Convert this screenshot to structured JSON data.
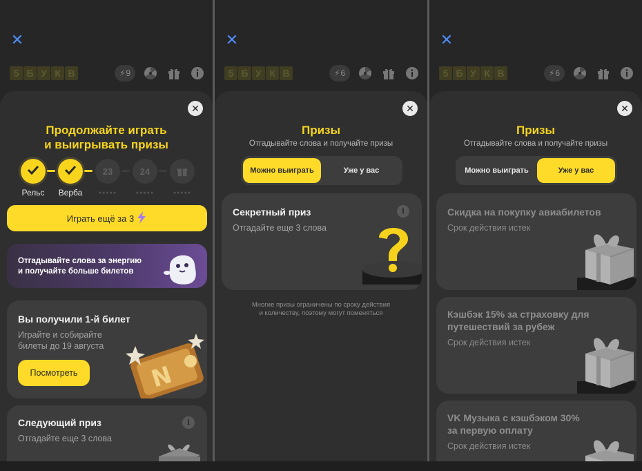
{
  "common": {
    "close_glyph": "✕",
    "sheet_close_glyph": "✕",
    "logo_letters": [
      "5",
      "Б",
      "У",
      "К",
      "В"
    ],
    "info_glyph": "i",
    "accent": "#fddb28",
    "close_color": "#4e8df5"
  },
  "screen1": {
    "energy_count": "9",
    "title_line1": "Продолжайте играть",
    "title_line2": "и выигрывать призы",
    "steps": [
      {
        "label": "Рельс",
        "state": "done"
      },
      {
        "label": "Верба",
        "state": "done"
      },
      {
        "label": "23",
        "state": "todo"
      },
      {
        "label": "24",
        "state": "todo"
      },
      {
        "label": "gift-icon",
        "state": "todo"
      }
    ],
    "step_dots": "●●●●●",
    "play_button": "Играть ещё за 3",
    "promo_line1": "Отгадывайте слова за энергию",
    "promo_line2": "и получайте больше билетов",
    "ticket_title": "Вы получили 1-й билет",
    "ticket_sub_line1": "Играйте и собирайте",
    "ticket_sub_line2": "билеты до 19 августа",
    "ticket_button": "Посмотреть",
    "next_title": "Следующий приз",
    "next_sub": "Отгадайте еще 3 слова"
  },
  "screen2": {
    "energy_count": "6",
    "title": "Призы",
    "subtitle": "Отгадывайте слова и получайте призы",
    "tab_win": "Можно выиграть",
    "tab_have": "Уже у вас",
    "secret_title": "Секретный приз",
    "secret_sub": "Отгадайте еще 3 слова",
    "note_line1": "Многие призы ограничены по сроку действия",
    "note_line2": "и количеству, поэтому могут поменяться"
  },
  "screen3": {
    "energy_count": "6",
    "title": "Призы",
    "subtitle": "Отгадывайте слова и получайте призы",
    "tab_win": "Можно выиграть",
    "tab_have": "Уже у вас",
    "prizes": [
      {
        "title_line1": "Скидка на покупку авиабилетов",
        "title_line2": "",
        "status": "Срок действия истек"
      },
      {
        "title_line1": "Кэшбэк 15% за страховку для",
        "title_line2": "путешествий за рубеж",
        "status": "Срок действия истек"
      },
      {
        "title_line1": "VK Музыка с кэшбэком 30%",
        "title_line2": "за первую оплату",
        "status": "Срок действия истек"
      }
    ]
  }
}
